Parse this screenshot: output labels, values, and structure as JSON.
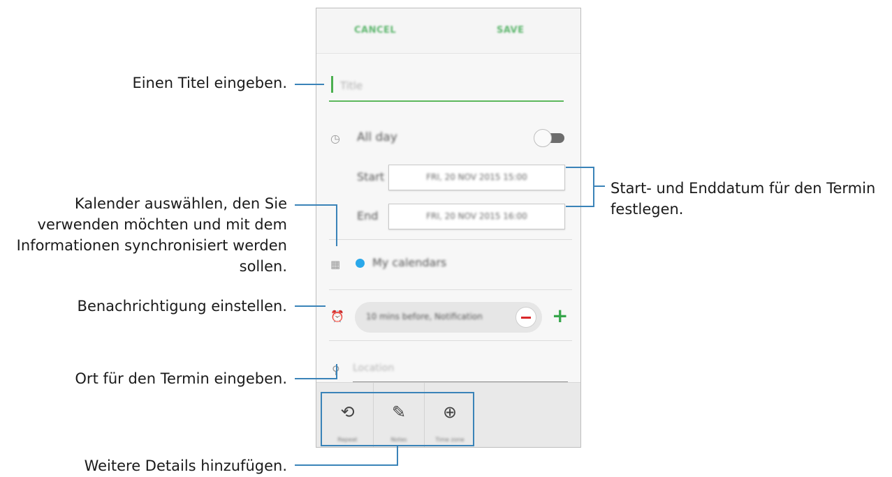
{
  "event_form": {
    "cancel_label": "CANCEL",
    "save_label": "SAVE",
    "title_placeholder": "Title",
    "all_day_label": "All day",
    "all_day_on": false,
    "start_label": "Start",
    "start_value": "FRI, 20 NOV 2015 15:00",
    "end_label": "End",
    "end_value": "FRI, 20 NOV 2015 16:00",
    "calendar_label": "My calendars",
    "calendar_color": "#2aa8ea",
    "reminder_value": "10 mins before, Notification",
    "location_placeholder": "Location",
    "tools": [
      {
        "label": "Repeat",
        "icon": "repeat-icon"
      },
      {
        "label": "Notes",
        "icon": "notes-icon"
      },
      {
        "label": "Time zone",
        "icon": "time-zone-icon"
      }
    ]
  },
  "callouts": {
    "title": "Einen Titel eingeben.",
    "dates_line1": "Start- und Enddatum für den Termin",
    "dates_line2": "festlegen.",
    "calendar_line1": "Kalender auswählen, den Sie",
    "calendar_line2": "verwenden möchten und mit dem",
    "calendar_line3": "Informationen synchronisiert werden",
    "calendar_line4": "sollen.",
    "alarm": "Benachrichtigung einstellen.",
    "location": "Ort für den Termin eingeben.",
    "details": "Weitere Details hinzufügen."
  },
  "colors": {
    "accent_green": "#37a64b",
    "callout_line": "#3a83b8",
    "remove_red": "#d9262a"
  }
}
